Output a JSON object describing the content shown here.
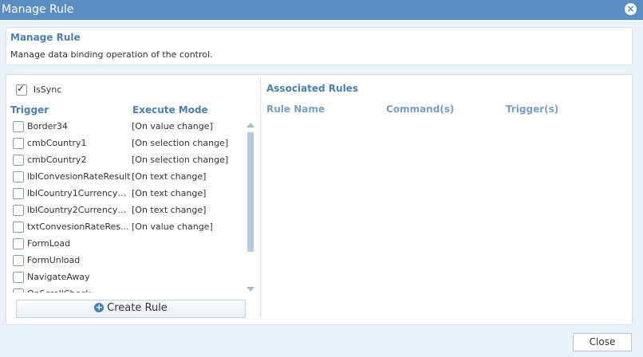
{
  "window": {
    "title": "Manage Rule",
    "close_icon": "close-icon"
  },
  "header": {
    "title": "Manage Rule",
    "description": "Manage data binding operation of the control."
  },
  "left": {
    "issync_label": "IsSync",
    "issync_checked": true,
    "trigger_header": "Trigger",
    "mode_header": "Execute Mode",
    "triggers": [
      {
        "name": "Border34",
        "mode": "[On value change]"
      },
      {
        "name": "cmbCountry1",
        "mode": "[On selection change]"
      },
      {
        "name": "cmbCountry2",
        "mode": "[On selection change]"
      },
      {
        "name": "lblConvesionRateResult",
        "mode": "[On text change]"
      },
      {
        "name": "lblCountry1CurrencyC...",
        "mode": "[On text change]"
      },
      {
        "name": "lblCountry2CurrencyC...",
        "mode": "[On text change]"
      },
      {
        "name": "txtConvesionRateRes...",
        "mode": "[On value change]"
      },
      {
        "name": "FormLoad",
        "mode": ""
      },
      {
        "name": "FormUnload",
        "mode": ""
      },
      {
        "name": "NavigateAway",
        "mode": ""
      },
      {
        "name": "OnScrollCheck",
        "mode": ""
      }
    ],
    "create_rule_label": "Create Rule"
  },
  "right": {
    "title": "Associated Rules",
    "columns": [
      "Rule Name",
      "Command(s)",
      "Trigger(s)"
    ]
  },
  "footer": {
    "close_label": "Close"
  }
}
